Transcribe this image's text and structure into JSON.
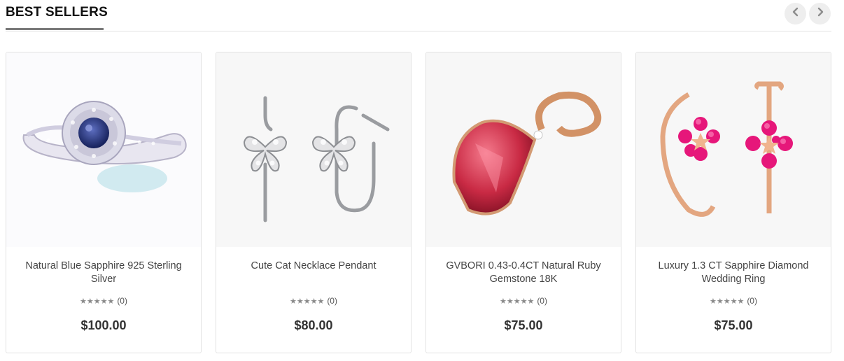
{
  "section": {
    "title": "BEST SELLERS"
  },
  "nav": {
    "prev_icon": "chevron-left-icon",
    "next_icon": "chevron-right-icon"
  },
  "products": [
    {
      "name": "Natural Blue Sapphire 925 Sterling Silver",
      "stars": "★★★★★",
      "rating_count": "(0)",
      "price": "$100.00",
      "image": "blue-sapphire-ring"
    },
    {
      "name": "Cute Cat Necklace Pendant",
      "stars": "★★★★★",
      "rating_count": "(0)",
      "price": "$80.00",
      "image": "butterfly-earrings"
    },
    {
      "name": "GVBORI 0.43-0.4CT Natural Ruby Gemstone 18K",
      "stars": "★★★★★",
      "rating_count": "(0)",
      "price": "$75.00",
      "image": "ruby-pendant"
    },
    {
      "name": "Luxury 1.3 CT Sapphire Diamond Wedding Ring",
      "stars": "★★★★★",
      "rating_count": "(0)",
      "price": "$75.00",
      "image": "pink-flower-hoop-earrings"
    }
  ],
  "colors": {
    "nav_bg": "#eeeeee",
    "underline": "#7a7a7a",
    "star": "#8a8a8a"
  }
}
